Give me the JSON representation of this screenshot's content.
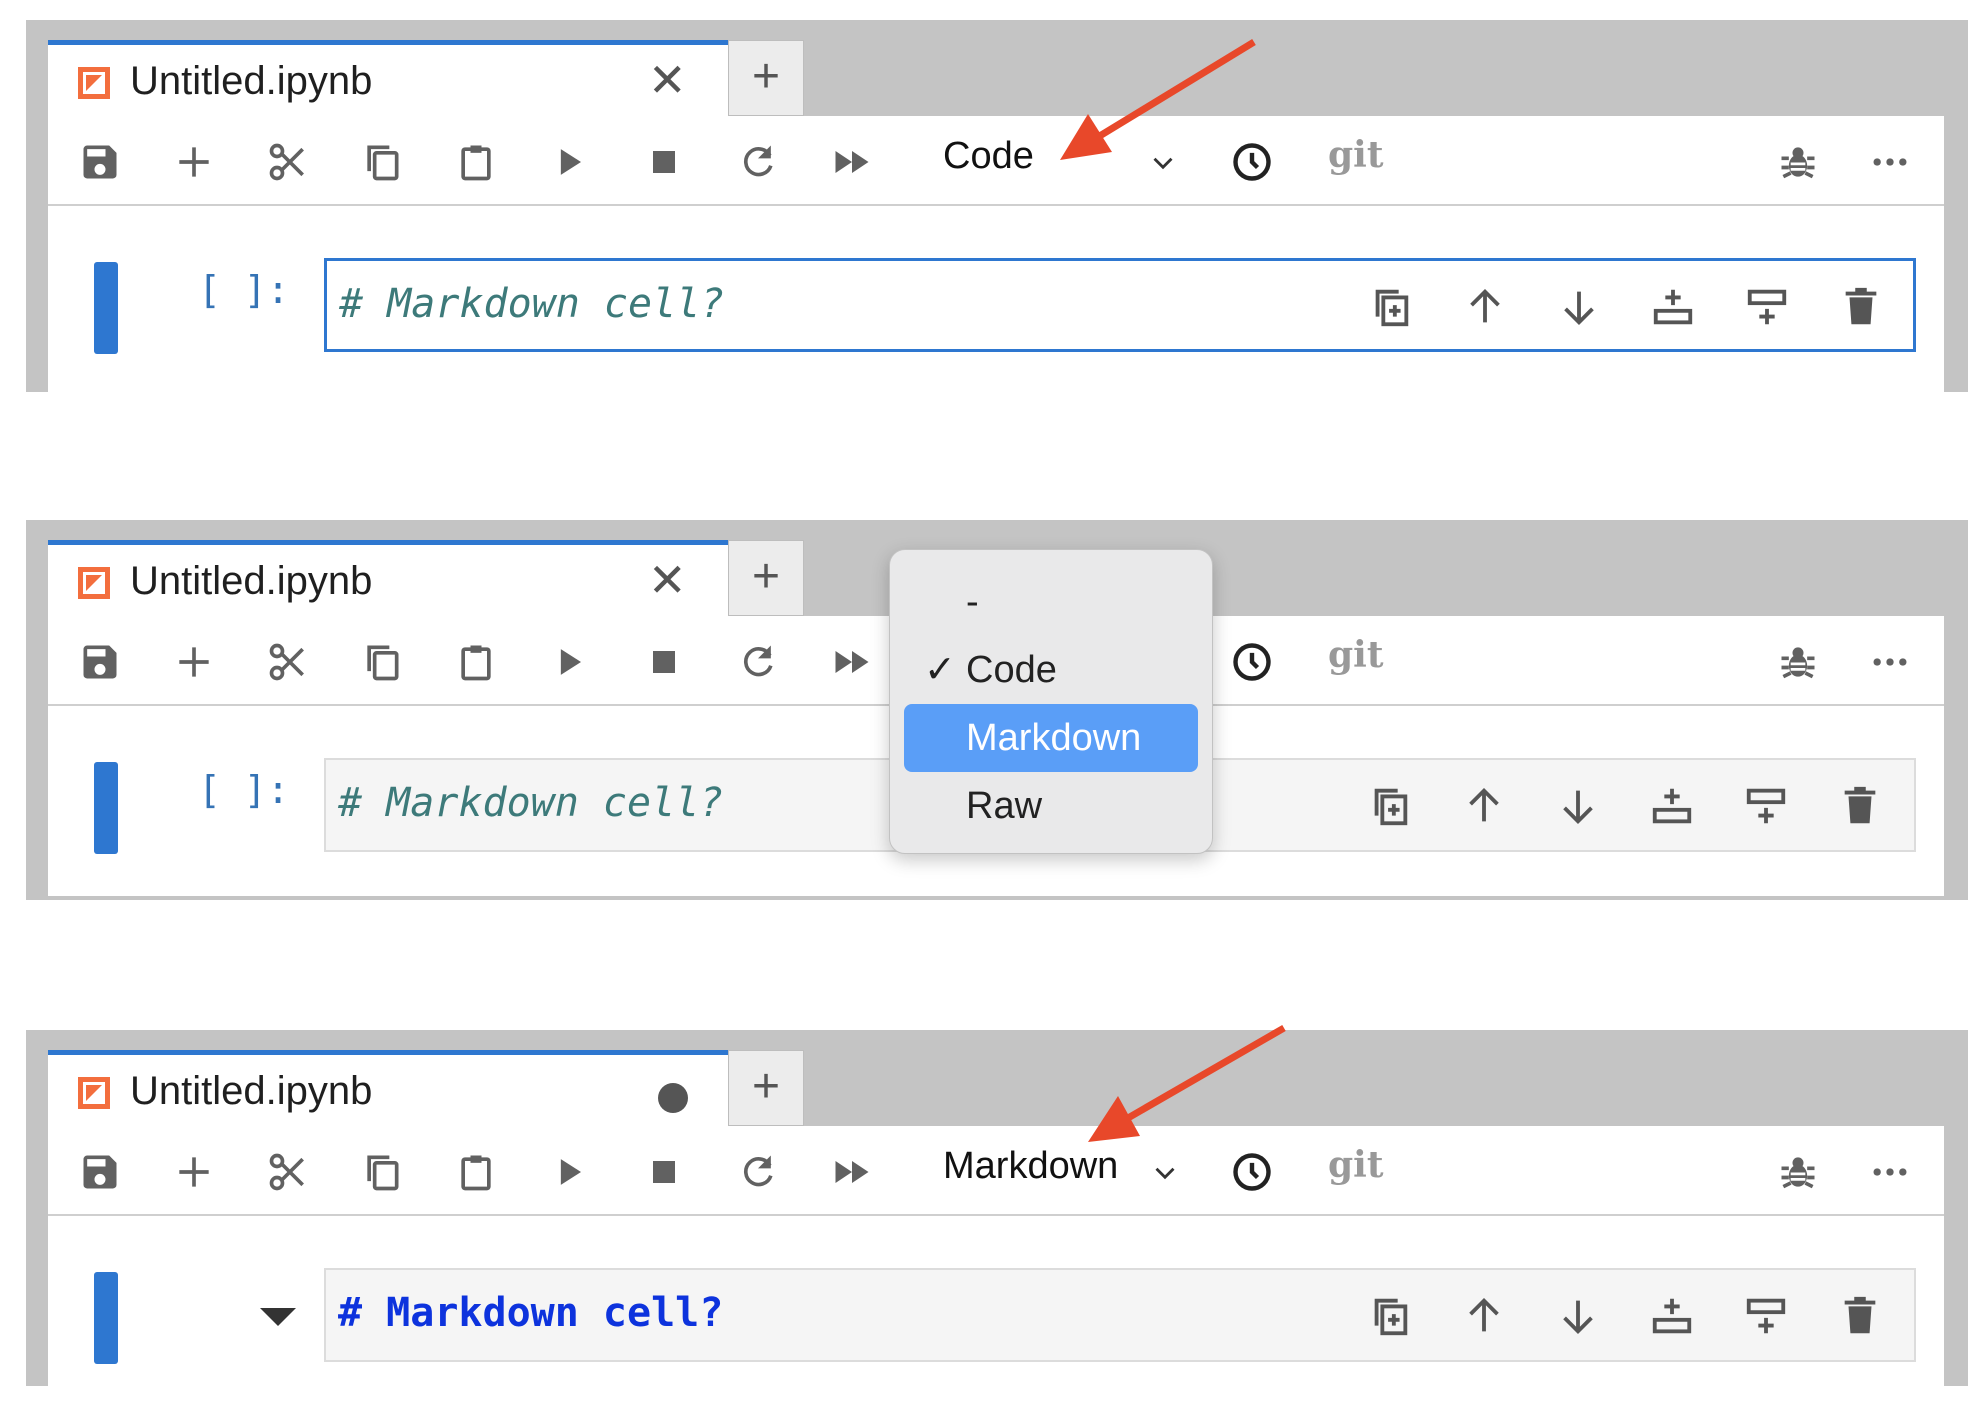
{
  "tab": {
    "title": "Untitled.ipynb",
    "close_symbol": "✕",
    "add_symbol": "+"
  },
  "toolbar": {
    "icons": [
      "save-icon",
      "add-icon",
      "cut-icon",
      "copy-icon",
      "paste-icon",
      "run-icon",
      "stop-icon",
      "restart-icon",
      "fast-forward-icon",
      "clock-icon",
      "bug-icon",
      "more-icon"
    ],
    "git_label": "git"
  },
  "panels": [
    {
      "cell_type": "Code",
      "prompt": "[ ]:",
      "cell_text": "# Markdown cell?",
      "cell_mode": "code",
      "tab_state": "clean",
      "annotation": "arrow pointing at cell type selector"
    },
    {
      "cell_type": "Code",
      "prompt": "[ ]:",
      "cell_text": "# Markdown cell?",
      "cell_mode": "code",
      "tab_state": "clean"
    },
    {
      "cell_type": "Markdown",
      "prompt": "",
      "cell_text": "# Markdown cell?",
      "cell_mode": "markdown",
      "tab_state": "modified",
      "annotation": "arrow pointing at cell type selector"
    }
  ],
  "dropdown": {
    "items": [
      {
        "label": "-",
        "checked": false,
        "highlighted": false
      },
      {
        "label": "Code",
        "checked": true,
        "highlighted": false
      },
      {
        "label": "Markdown",
        "checked": false,
        "highlighted": true
      },
      {
        "label": "Raw",
        "checked": false,
        "highlighted": false
      }
    ],
    "check_symbol": "✓"
  },
  "cell_actions": [
    "duplicate-icon",
    "move-up-icon",
    "move-down-icon",
    "insert-above-icon",
    "insert-below-icon",
    "delete-icon"
  ],
  "colors": {
    "accent": "#2e77d0",
    "arrow": "#e8482a",
    "dropdown_highlight": "#5a9ef7",
    "markdown_text": "#0d33dd",
    "code_comment": "#3d7a7a"
  }
}
